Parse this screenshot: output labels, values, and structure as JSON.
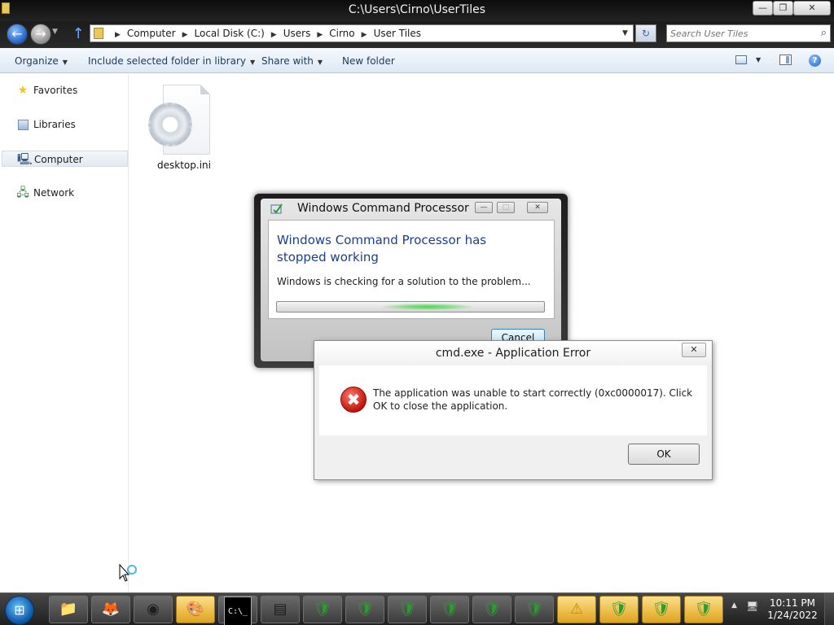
{
  "window": {
    "title": "C:\\Users\\Cirno\\UserTiles",
    "caption_buttons": {
      "minimize": "—",
      "maximize": "❐",
      "close": "✕"
    }
  },
  "addressbar": {
    "crumbs": [
      "Computer",
      "Local Disk (C:)",
      "Users",
      "Cirno",
      "User Tiles"
    ],
    "search_placeholder": "Search User Tiles"
  },
  "toolbar": {
    "organize": "Organize",
    "include": "Include selected folder in library",
    "share": "Share with",
    "new_folder": "New folder",
    "help": "?"
  },
  "navpane": {
    "items": [
      {
        "label": "Favorites",
        "icon": "star-icon"
      },
      {
        "label": "Libraries",
        "icon": "library-icon"
      },
      {
        "label": "Computer",
        "icon": "computer-icon",
        "selected": true
      },
      {
        "label": "Network",
        "icon": "network-icon"
      }
    ]
  },
  "files": [
    {
      "name": "desktop.ini",
      "icon": "gear-file-icon"
    }
  ],
  "wcp_dialog": {
    "title": "Windows Command Processor",
    "headline": "Windows Command Processor has stopped working",
    "message": "Windows is checking for a solution to the problem...",
    "cancel_label": "Cancel",
    "progress_state": "indeterminate",
    "buttons": {
      "minimize": "—",
      "maximize": "□",
      "close": "✕"
    }
  },
  "error_dialog": {
    "title": "cmd.exe - Application Error",
    "message": "The application was unable to start correctly (0xc0000017). Click OK to close the application.",
    "ok_label": "OK",
    "close": "✕",
    "icon": "error-icon",
    "icon_glyph": "✖"
  },
  "taskbar": {
    "pinned": [
      {
        "name": "explorer-taskbar-icon",
        "glyph": "📁",
        "active": false
      },
      {
        "name": "firefox-taskbar-icon",
        "glyph": "🦊",
        "active": false
      },
      {
        "name": "chrome-taskbar-icon",
        "glyph": "◉",
        "active": false
      },
      {
        "name": "paint-taskbar-icon",
        "glyph": "🎨",
        "active": true
      },
      {
        "name": "cmd-taskbar-icon",
        "glyph": "C:\\_",
        "active": false
      },
      {
        "name": "window-taskbar-icon",
        "glyph": "▤",
        "active": false
      },
      {
        "name": "installer-taskbar-icon-1",
        "glyph": "🛡",
        "active": false
      },
      {
        "name": "installer-taskbar-icon-2",
        "glyph": "🛡",
        "active": false
      },
      {
        "name": "installer-taskbar-icon-3",
        "glyph": "🛡",
        "active": false
      },
      {
        "name": "installer-taskbar-icon-4",
        "glyph": "🛡",
        "active": false
      },
      {
        "name": "installer-taskbar-icon-5",
        "glyph": "🛡",
        "active": false
      },
      {
        "name": "installer-taskbar-icon-6",
        "glyph": "🛡",
        "active": false
      },
      {
        "name": "warning-taskbar-icon",
        "glyph": "⚠",
        "active": true
      },
      {
        "name": "installer-taskbar-icon-7",
        "glyph": "🛡",
        "active": true
      },
      {
        "name": "installer-taskbar-icon-8",
        "glyph": "🛡",
        "active": true
      },
      {
        "name": "installer-taskbar-icon-9",
        "glyph": "🛡",
        "active": true
      }
    ],
    "clock_time": "10:11 PM",
    "clock_date": "1/24/2022"
  }
}
